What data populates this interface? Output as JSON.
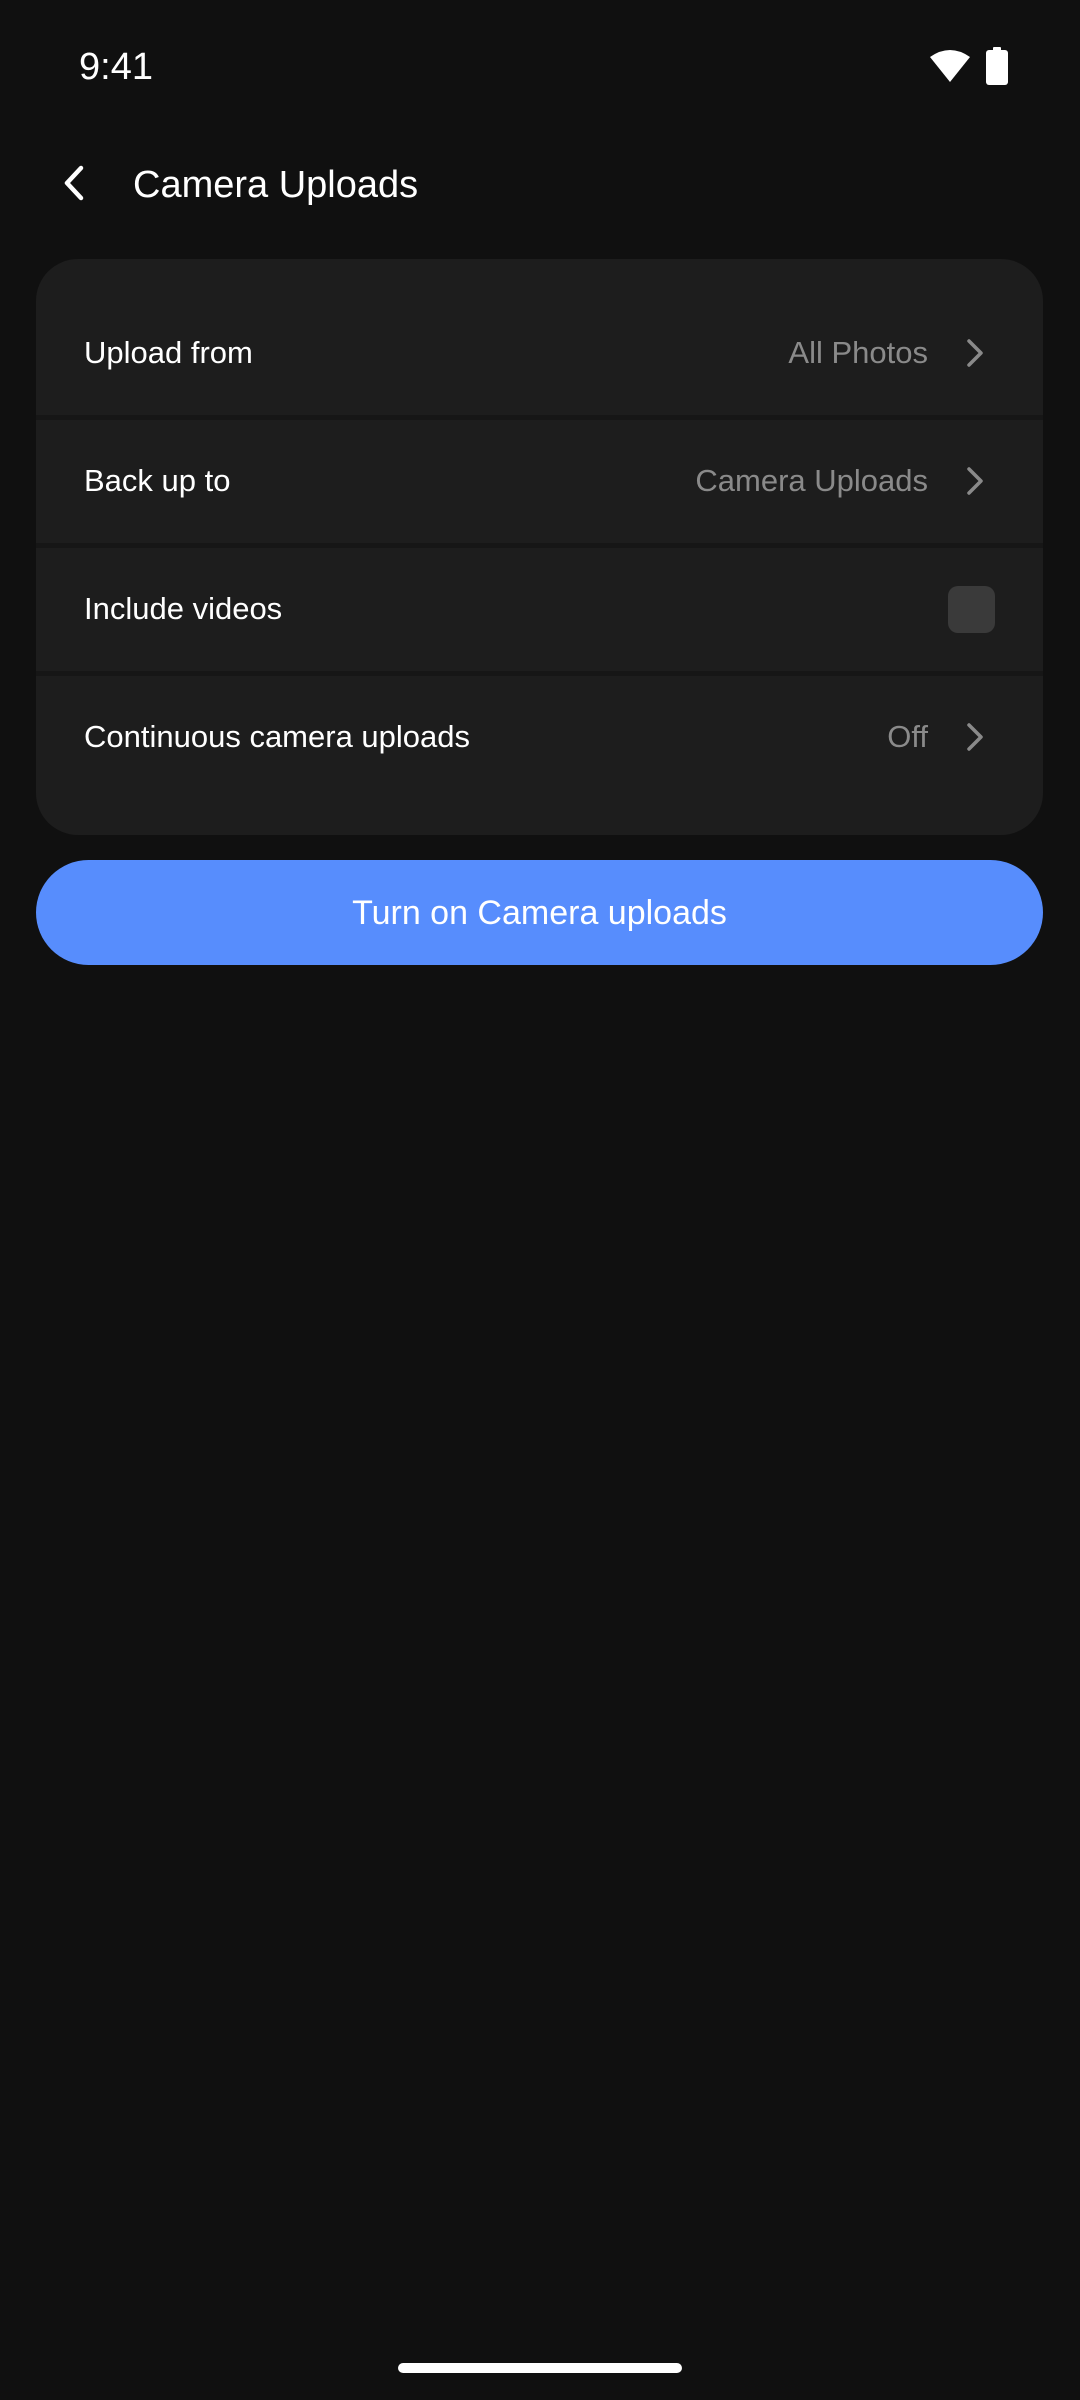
{
  "status_bar": {
    "time": "9:41",
    "icons": [
      "wifi-icon",
      "battery-icon"
    ]
  },
  "header": {
    "back_icon": "chevron-left-icon",
    "title": "Camera Uploads"
  },
  "settings": {
    "items": [
      {
        "label": "Upload from",
        "value": "All Photos",
        "control": "chevron-right-icon"
      },
      {
        "label": "Back up to",
        "value": "Camera Uploads",
        "control": "chevron-right-icon"
      },
      {
        "label": "Include videos",
        "checked": false,
        "control": "checkbox"
      },
      {
        "label": "Continuous camera uploads",
        "value": "Off",
        "control": "chevron-right-icon"
      }
    ]
  },
  "primary_action": {
    "label": "Turn on Camera uploads"
  },
  "colors": {
    "background": "#101010",
    "card": "#1d1d1d",
    "accent": "#578dfd",
    "secondary_text": "#8a8a8a",
    "checkbox": "#3a3a3a"
  }
}
